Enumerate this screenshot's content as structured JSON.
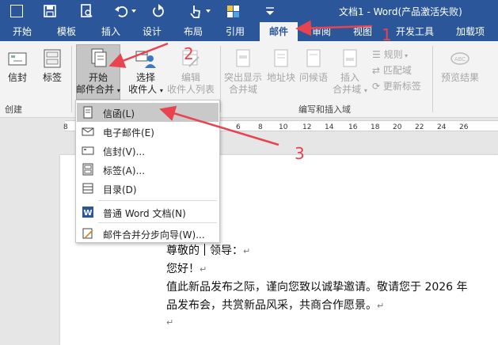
{
  "window": {
    "title": "文档1 - Word(产品激活失败)"
  },
  "tabs": [
    "开始",
    "模板",
    "插入",
    "设计",
    "布局",
    "引用",
    "邮件",
    "审阅",
    "视图",
    "开发工具",
    "加载项"
  ],
  "ribbon": {
    "create": {
      "envelope": "信封",
      "labels": "标签",
      "group": "创建"
    },
    "start": {
      "line1": "开始",
      "line2": "邮件合并"
    },
    "select": {
      "line1": "选择",
      "line2": "收件人"
    },
    "edit": {
      "line1": "编辑",
      "line2": "收件人列表"
    },
    "highlight": {
      "line1": "突出显示",
      "line2": "合并域"
    },
    "address": "地址块",
    "greeting": "问候语",
    "insert_field": {
      "line1": "插入",
      "line2": "合并域"
    },
    "rules": "规则",
    "match": "匹配域",
    "update": "更新标签",
    "write_group": "编写和插入域",
    "preview": "预览结果"
  },
  "ruler": [
    "8",
    "6",
    "8",
    "10",
    "12",
    "14",
    "16",
    "18",
    "20",
    "22",
    "24",
    "26"
  ],
  "menu": {
    "items": [
      {
        "label": "信函(L)",
        "icon": "letter-icon"
      },
      {
        "label": "电子邮件(E)",
        "icon": "email-icon"
      },
      {
        "label": "信封(V)...",
        "icon": "envelope-icon"
      },
      {
        "label": "标签(A)...",
        "icon": "labels-icon"
      },
      {
        "label": "目录(D)",
        "icon": "directory-icon"
      },
      {
        "label": "普通 Word 文档(N)",
        "icon": "word-doc-icon"
      },
      {
        "label": "邮件合并分步向导(W)...",
        "icon": "wizard-icon"
      }
    ]
  },
  "document": {
    "line1a": "尊敬的",
    "line1b": "领导：",
    "line2": "您好！",
    "line3": "值此新品发布之际，谨向您致以诚挚邀请。敬请您于 2026 年",
    "line4": "品发布会，共赏新品风采，共商合作愿景。",
    "para_mark": "↵"
  },
  "annotations": {
    "one": "1",
    "two": "2",
    "three": "3"
  },
  "colors": {
    "word_blue": "#2b579a",
    "annotation_red": "#e8434f"
  }
}
